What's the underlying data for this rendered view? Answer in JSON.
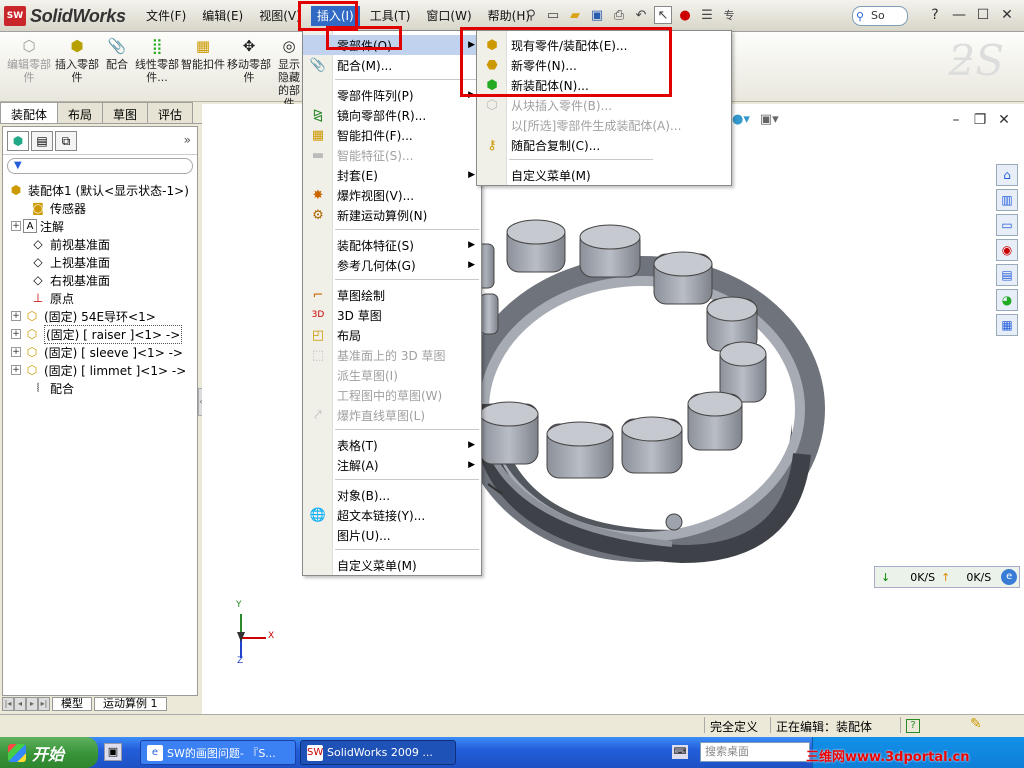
{
  "app": {
    "name": "SolidWorks",
    "logo_badge": "SW"
  },
  "menubar": {
    "items": [
      "文件(F)",
      "编辑(E)",
      "视图(V)",
      "插入(I)",
      "工具(T)",
      "窗口(W)",
      "帮助(H)"
    ],
    "active_index": 3
  },
  "toolbar": {
    "icons": [
      "pin-icon",
      "new-icon",
      "open-icon",
      "save-icon",
      "print-icon",
      "undo-icon",
      "select-icon",
      "traffic-light-icon",
      "options-icon"
    ],
    "truncated_label": "专",
    "search_text": "So",
    "help_glyph": "?"
  },
  "command_manager": {
    "buttons": [
      {
        "label": "编辑零部件",
        "icon": "edit-component-icon",
        "enabled": false
      },
      {
        "label": "插入零部件",
        "icon": "insert-component-icon",
        "enabled": true
      },
      {
        "label": "配合",
        "icon": "mate-icon",
        "enabled": true
      },
      {
        "label": "线性零部件...",
        "icon": "linear-pattern-icon",
        "enabled": true
      },
      {
        "label": "智能扣件",
        "icon": "smart-fastener-icon",
        "enabled": true
      },
      {
        "label": "移动零部件",
        "icon": "move-component-icon",
        "enabled": true
      },
      {
        "label": "显示隐藏的部件",
        "icon": "show-hidden-icon",
        "enabled": true
      }
    ]
  },
  "tabs": [
    "装配体",
    "布局",
    "草图",
    "评估"
  ],
  "active_tab": 0,
  "feature_tree": {
    "items": [
      {
        "label": "装配体1  (默认<显示状态-1>)",
        "icon": "assembly-icon",
        "expander": "",
        "indent": 0
      },
      {
        "label": "传感器",
        "icon": "sensor-icon",
        "expander": "",
        "indent": 1
      },
      {
        "label": "注解",
        "icon": "annotation-icon",
        "expander": "+",
        "indent": 1
      },
      {
        "label": "前视基准面",
        "icon": "plane-icon",
        "expander": "",
        "indent": 1
      },
      {
        "label": "上视基准面",
        "icon": "plane-icon",
        "expander": "",
        "indent": 1
      },
      {
        "label": "右视基准面",
        "icon": "plane-icon",
        "expander": "",
        "indent": 1
      },
      {
        "label": "原点",
        "icon": "origin-icon",
        "expander": "",
        "indent": 1
      },
      {
        "label": "(固定) 54E导环<1>",
        "icon": "part-icon",
        "expander": "+",
        "indent": 1
      },
      {
        "label": "(固定) [ raiser ]<1> ->",
        "icon": "part-icon",
        "expander": "+",
        "indent": 1,
        "selected": true
      },
      {
        "label": "(固定) [ sleeve ]<1> ->",
        "icon": "part-icon",
        "expander": "+",
        "indent": 1
      },
      {
        "label": "(固定) [ limmet ]<1> ->",
        "icon": "part-icon",
        "expander": "+",
        "indent": 1
      },
      {
        "label": "配合",
        "icon": "mates-folder-icon",
        "expander": "",
        "indent": 1
      }
    ]
  },
  "bottom_tabs": [
    "模型",
    "运动算例 1"
  ],
  "insert_menu": {
    "items": [
      {
        "label": "零部件(O)",
        "icon": "",
        "enabled": true,
        "submenu": true,
        "highlighted": true
      },
      {
        "label": "配合(M)...",
        "icon": "mate-icon",
        "enabled": true
      },
      {
        "sep": true
      },
      {
        "label": "零部件阵列(P)",
        "icon": "",
        "enabled": true,
        "submenu": true
      },
      {
        "label": "镜向零部件(R)...",
        "icon": "mirror-icon",
        "enabled": true
      },
      {
        "label": "智能扣件(F)...",
        "icon": "smart-fastener-icon",
        "enabled": true
      },
      {
        "label": "智能特征(S)...",
        "icon": "smart-feature-icon",
        "enabled": false
      },
      {
        "label": "封套(E)",
        "icon": "",
        "enabled": true,
        "submenu": true
      },
      {
        "label": "爆炸视图(V)...",
        "icon": "explode-icon",
        "enabled": true
      },
      {
        "label": "新建运动算例(N)",
        "icon": "motion-study-icon",
        "enabled": true
      },
      {
        "sep": true
      },
      {
        "label": "装配体特征(S)",
        "icon": "",
        "enabled": true,
        "submenu": true
      },
      {
        "label": "参考几何体(G)",
        "icon": "",
        "enabled": true,
        "submenu": true
      },
      {
        "sep": true
      },
      {
        "label": "草图绘制",
        "icon": "sketch-icon",
        "enabled": true
      },
      {
        "label": "3D 草图",
        "icon": "3d-sketch-icon",
        "enabled": true
      },
      {
        "label": "布局",
        "icon": "layout-icon",
        "enabled": true
      },
      {
        "label": "基准面上的 3D 草图",
        "icon": "3d-sketch-plane-icon",
        "enabled": false
      },
      {
        "label": "派生草图(I)",
        "icon": "",
        "enabled": false
      },
      {
        "label": "工程图中的草图(W)",
        "icon": "",
        "enabled": false
      },
      {
        "label": "爆炸直线草图(L)",
        "icon": "explode-line-icon",
        "enabled": false
      },
      {
        "sep": true
      },
      {
        "label": "表格(T)",
        "icon": "",
        "enabled": true,
        "submenu": true
      },
      {
        "label": "注解(A)",
        "icon": "",
        "enabled": true,
        "submenu": true
      },
      {
        "sep": true
      },
      {
        "label": "对象(B)...",
        "icon": "",
        "enabled": true
      },
      {
        "label": "超文本链接(Y)...",
        "icon": "hyperlink-icon",
        "enabled": true
      },
      {
        "label": "图片(U)...",
        "icon": "",
        "enabled": true
      },
      {
        "sep": true
      },
      {
        "label": "自定义菜单(M)",
        "icon": "",
        "enabled": true
      }
    ]
  },
  "component_submenu": {
    "items": [
      {
        "label": "现有零件/装配体(E)...",
        "icon": "existing-part-icon",
        "enabled": true
      },
      {
        "label": "新零件(N)...",
        "icon": "new-part-icon",
        "enabled": true
      },
      {
        "label": "新装配体(N)...",
        "icon": "new-assembly-icon",
        "enabled": true
      },
      {
        "label": "从块插入零件(B)...",
        "icon": "block-part-icon",
        "enabled": false
      },
      {
        "label": "以[所选]零部件生成装配体(A)...",
        "icon": "",
        "enabled": false
      },
      {
        "label": "随配合复制(C)...",
        "icon": "copy-with-mates-icon",
        "enabled": true
      },
      {
        "sep": true
      },
      {
        "label": "自定义菜单(M)",
        "icon": "",
        "enabled": true
      }
    ]
  },
  "network_monitor": {
    "down": "0K/S",
    "up": "0K/S"
  },
  "statusbar": {
    "state": "完全定义",
    "editing": "正在编辑：装配体",
    "help": "?"
  },
  "taskbar": {
    "start_label": "开始",
    "buttons": [
      {
        "label": "SW的画图问题- 『S...",
        "icon": "ie-icon"
      },
      {
        "label": "SolidWorks 2009 ...",
        "icon": "solidworks-icon"
      }
    ],
    "search_placeholder": "搜索桌面"
  },
  "watermark": "三维网www.3dportal.cn",
  "triad": {
    "x_label": "X",
    "y_label": "Y",
    "z_label": "Z"
  },
  "colors": {
    "highlight": "#316ac5",
    "menu_highlight": "#c1d2ee",
    "annotation_red": "#e00000",
    "model_gray": "#9ea3ad"
  }
}
